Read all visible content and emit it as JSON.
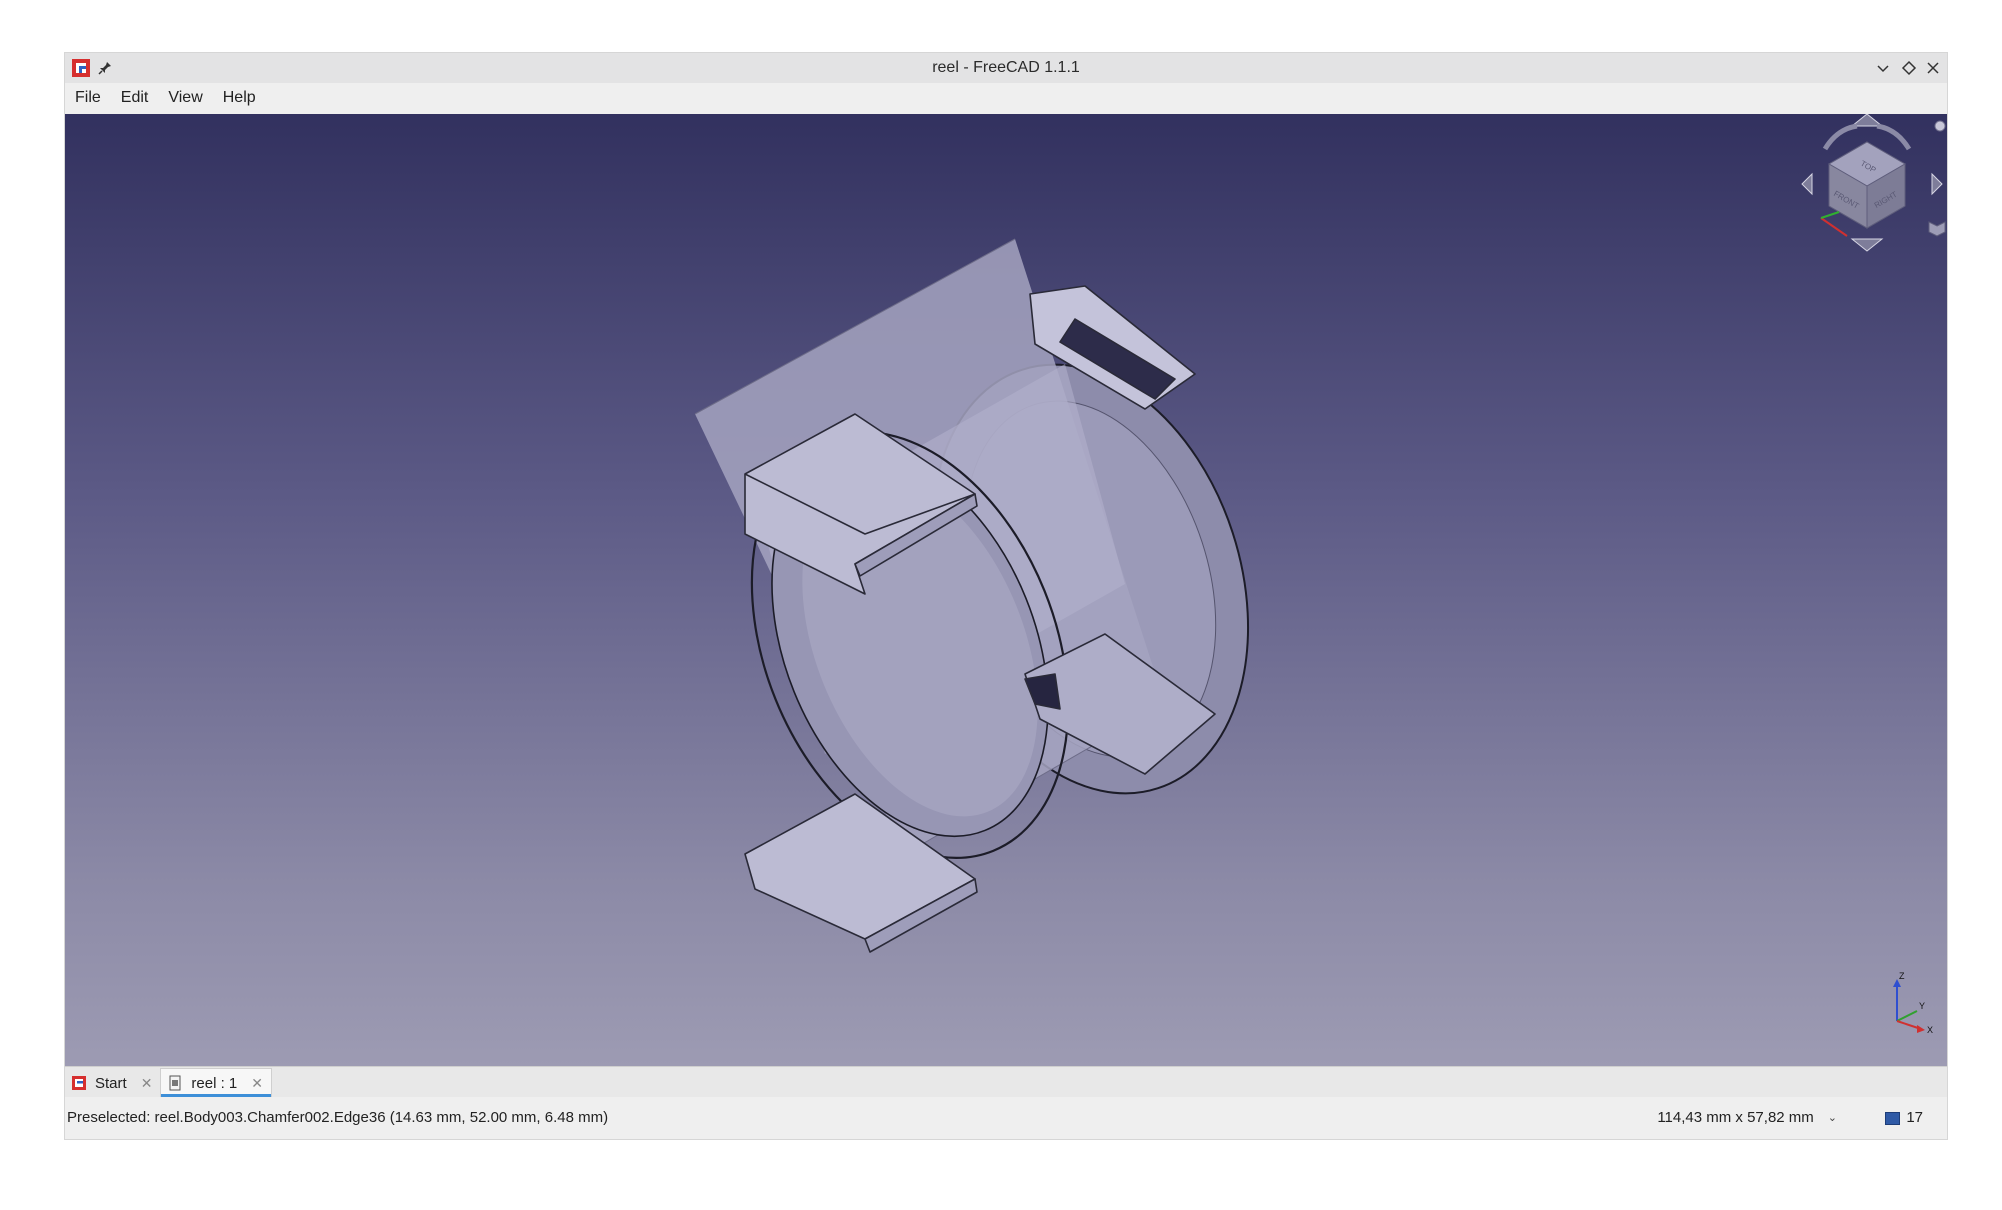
{
  "window": {
    "title": "reel - FreeCAD 1.1.1"
  },
  "menu": [
    "File",
    "Edit",
    "View",
    "Help"
  ],
  "navcube": {
    "faces": [
      "TOP",
      "FRONT",
      "RIGHT"
    ]
  },
  "axis": {
    "x": "X",
    "y": "Y",
    "z": "Z"
  },
  "tabs": [
    {
      "label": "Start",
      "active": false
    },
    {
      "label": "reel : 1",
      "active": true
    }
  ],
  "status": {
    "message": "Preselected: reel.Body003.Chamfer002.Edge36 (14.63 mm, 52.00 mm, 6.48 mm)",
    "dimensions": "114,43 mm x 57,82 mm",
    "count": "17"
  },
  "colors": {
    "viewport_top": "#32315f",
    "viewport_bottom": "#9d9bb3",
    "tab_active_accent": "#3d8fd8",
    "model_fill": "#a9a9c6"
  }
}
